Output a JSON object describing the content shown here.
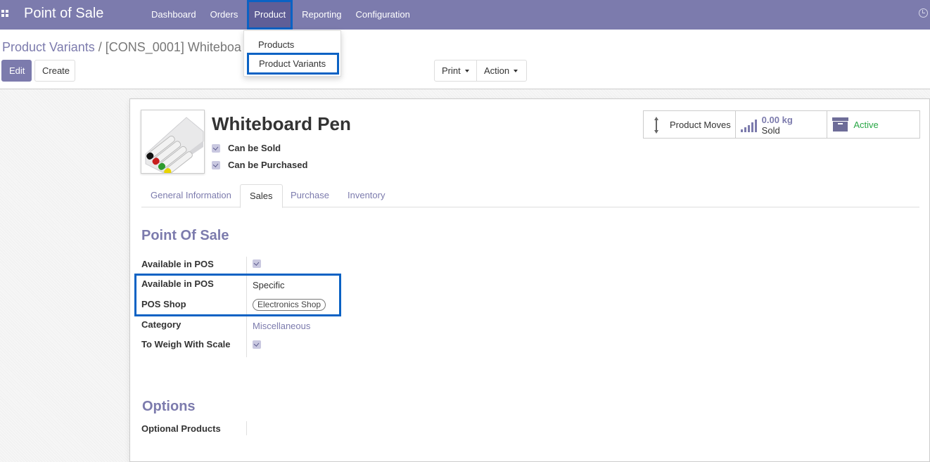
{
  "navbar": {
    "brand": "Point of Sale",
    "menu": [
      "Dashboard",
      "Orders",
      "Product",
      "Reporting",
      "Configuration"
    ]
  },
  "dropdown": {
    "items": [
      "Products",
      "Product Variants"
    ]
  },
  "breadcrumb": {
    "parent": "Product Variants",
    "separator": "/",
    "current": "[CONS_0001] Whiteboa"
  },
  "buttons": {
    "edit": "Edit",
    "create": "Create",
    "print": "Print",
    "action": "Action"
  },
  "product": {
    "name": "Whiteboard Pen",
    "can_be_sold_label": "Can be Sold",
    "can_be_purchased_label": "Can be Purchased"
  },
  "smart_buttons": {
    "moves_label": "Product Moves",
    "sold_value": "0.00 kg",
    "sold_label": "Sold",
    "active_label": "Active"
  },
  "tabs": [
    "General Information",
    "Sales",
    "Purchase",
    "Inventory"
  ],
  "pos_section": {
    "title": "Point Of Sale",
    "available_in_pos_label": "Available in POS",
    "available_in_pos_mode_label": "Available in POS",
    "available_in_pos_mode_value": "Specific",
    "pos_shop_label": "POS Shop",
    "pos_shop_value": "Electronics Shop",
    "category_label": "Category",
    "category_value": "Miscellaneous",
    "weigh_label": "To Weigh With Scale"
  },
  "options_section": {
    "title": "Options",
    "optional_products_label": "Optional Products"
  },
  "colors": {
    "brand": "#7c7bad",
    "highlight": "#0b62c4",
    "active": "#28a745"
  }
}
